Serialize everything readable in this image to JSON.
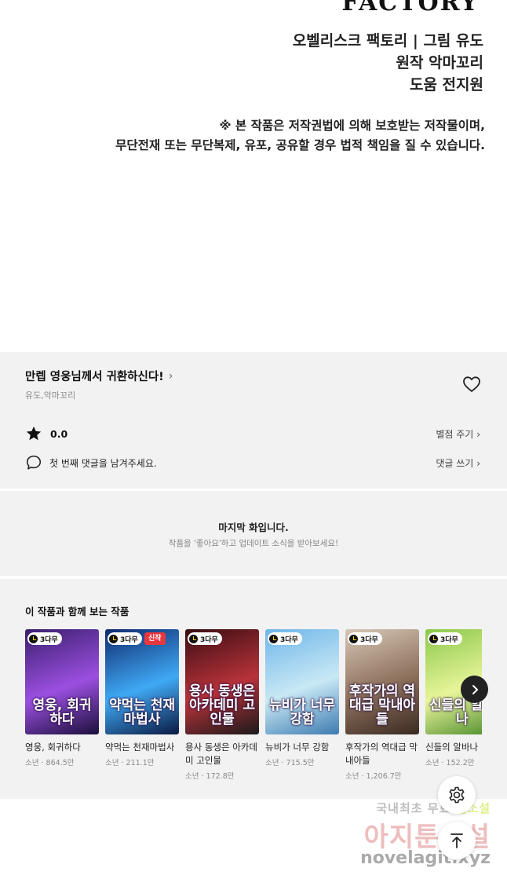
{
  "credits": {
    "brand": "FACTORY",
    "line1": "오벨리스크 팩토리  | 그림 유도",
    "line2": "원작 악마꼬리",
    "line3": "도움 전지원",
    "copyright1": "※ 본 작품은 저작권법에 의해 보호받는 저작물이며,",
    "copyright2": "무단전재 또는 무단복제, 유포, 공유할 경우 법적 책임을 질 수 있습니다."
  },
  "episode": {
    "title": "만렙 영웅님께서 귀환하신다!",
    "title_chevron": "›",
    "authors": "유도,악마꼬리",
    "rating": "0.0",
    "rate_link": "별점 주기",
    "comment_prompt": "첫 번째 댓글을 남겨주세요.",
    "comment_link": "댓글 쓰기",
    "link_chevron": "›"
  },
  "last_episode": {
    "title": "마지막 화입니다.",
    "subtitle": "작품을 '좋아요'하고 업데이트 소식을 받아보세요!"
  },
  "recommendations": {
    "title": "이 작품과 함께 보는 작품",
    "badge_label": "3다무",
    "new_label": "신작",
    "items": [
      {
        "name": "영웅, 회귀하다",
        "cover_title": "영웅, 회귀하다",
        "meta": "소년 · 864.5만",
        "colors": [
          "#3a1f6e",
          "#9b4fe0",
          "#1a0f3a"
        ]
      },
      {
        "name": "약먹는 천재마법사",
        "cover_title": "약먹는 천재마법사",
        "meta": "소년 · 211.1만",
        "colors": [
          "#0f2a6e",
          "#3fa9f5",
          "#0a1840"
        ]
      },
      {
        "name": "용사 동생은 아카데미 고인물",
        "cover_title": "용사 동생은 아카데미 고인물",
        "meta": "소년 · 172.8만",
        "colors": [
          "#3a0e12",
          "#b8323a",
          "#1a1a1a"
        ]
      },
      {
        "name": "뉴비가 너무 강함",
        "cover_title": "뉴비가 너무 강함",
        "meta": "소년 · 715.5만",
        "colors": [
          "#6fb6e8",
          "#c8e8f5",
          "#3d7bb0"
        ]
      },
      {
        "name": "후작가의 역대급 막내아들",
        "cover_title": "후작가의 역대급 막내아들",
        "meta": "소년 · 1,206.7만",
        "colors": [
          "#d8c7b6",
          "#8a6e5a",
          "#3b2a22"
        ]
      },
      {
        "name": "신들의 알바나",
        "cover_title": "신들의 알바나",
        "meta": "소년 · 152.2만",
        "colors": [
          "#8cc84b",
          "#e8f59a",
          "#4a8a2a"
        ]
      }
    ]
  },
  "watermark": {
    "line1_a": "국내최초 무료 ",
    "line1_b": "웹소설",
    "line2": "아지툰소설",
    "line3": "novelagit.xyz"
  },
  "icons": {
    "heart": "heart-icon",
    "star": "star-icon",
    "comment": "comment-icon",
    "settings": "gear-icon",
    "top": "arrow-up-icon",
    "next": "chevron-right-icon"
  }
}
